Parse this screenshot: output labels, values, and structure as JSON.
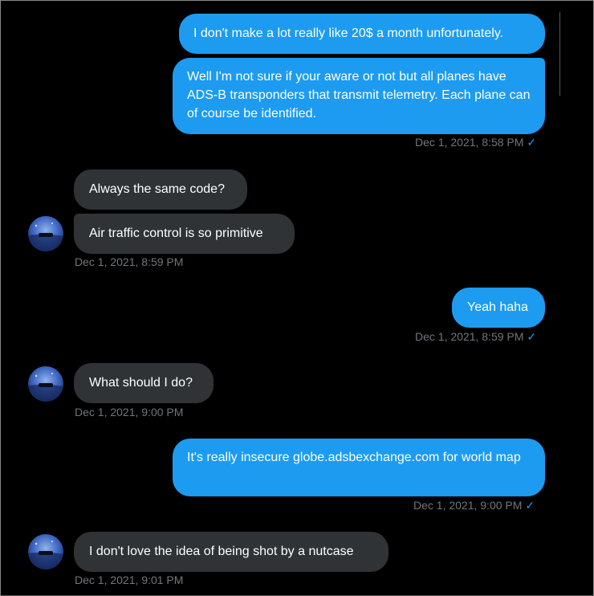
{
  "conversation": {
    "messages": [
      {
        "id": "m1",
        "direction": "out",
        "text": "I don't make a lot really like 20$ a month unfortunately."
      },
      {
        "id": "m2",
        "direction": "out",
        "text": "Well I'm not sure if your aware or not but all planes have ADS-B transponders that transmit telemetry. Each plane can of course be identified."
      },
      {
        "id": "m3",
        "direction": "in",
        "text": "Always the same code?"
      },
      {
        "id": "m4",
        "direction": "in",
        "text": "Air traffic control is so primitive"
      },
      {
        "id": "m5",
        "direction": "out",
        "text": "Yeah haha"
      },
      {
        "id": "m6",
        "direction": "in",
        "text": "What should I do?"
      },
      {
        "id": "m7",
        "direction": "out",
        "text": "It's really insecure globe.adsbexchange.com for world map"
      },
      {
        "id": "m8",
        "direction": "in",
        "text": "I don't love the idea of being shot by a nutcase"
      }
    ],
    "timestamps": {
      "t1": "Dec 1, 2021, 8:58 PM",
      "t2": "Dec 1, 2021, 8:59 PM",
      "t3": "Dec 1, 2021, 8:59 PM",
      "t4": "Dec 1, 2021, 9:00 PM",
      "t5": "Dec 1, 2021, 9:00 PM",
      "t6": "Dec 1, 2021, 9:01 PM"
    },
    "read_check": "✓"
  },
  "colors": {
    "outgoing_bubble": "#1d9bf0",
    "incoming_bubble": "#2f3336",
    "timestamp": "#71767b",
    "background": "#000000"
  },
  "icons": {
    "avatar": "user-avatar-icon",
    "read_receipt": "checkmark-icon"
  }
}
